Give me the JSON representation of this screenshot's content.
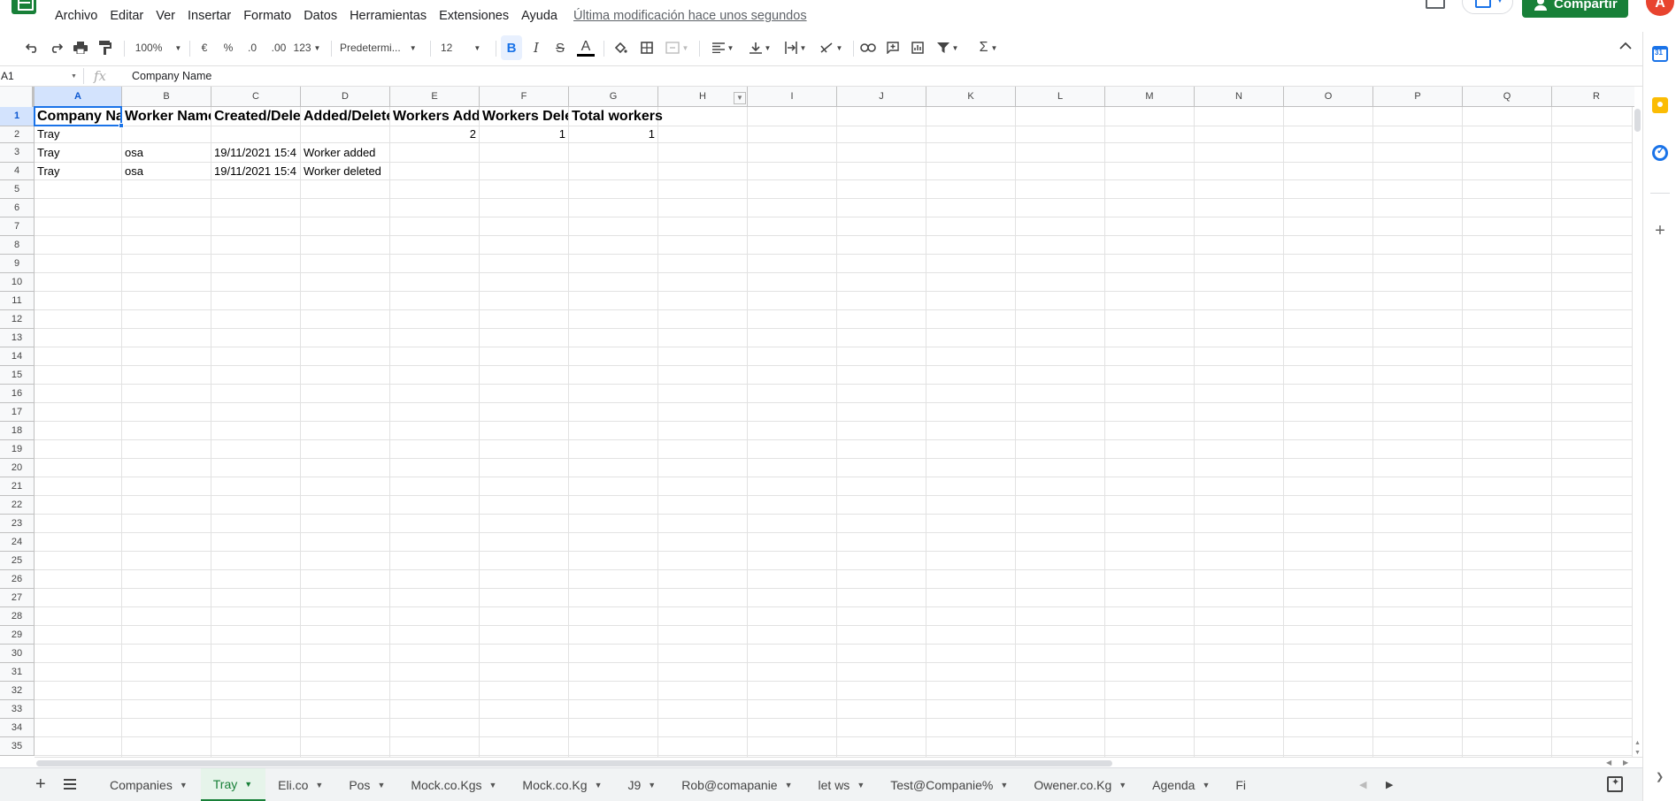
{
  "menu": {
    "items": [
      "Archivo",
      "Editar",
      "Ver",
      "Insertar",
      "Formato",
      "Datos",
      "Herramientas",
      "Extensiones",
      "Ayuda"
    ],
    "last_edit": "Última modificación hace unos segundos"
  },
  "header": {
    "share_label": "Compartir",
    "avatar_letter": "A"
  },
  "toolbar": {
    "zoom": "100%",
    "currency": "€",
    "percent": "%",
    "decrease_decimals": ".0",
    "increase_decimals": ".00",
    "more_formats": "123",
    "font": "Predetermi...",
    "font_size": "12",
    "bold": "B",
    "italic": "I",
    "strikethrough": "S",
    "text_color": "A",
    "functions": "Σ"
  },
  "formula_bar": {
    "cell_ref": "A1",
    "fx": "fx",
    "value": "Company Name"
  },
  "grid": {
    "columns": [
      "A",
      "B",
      "C",
      "D",
      "E",
      "F",
      "G",
      "H",
      "I",
      "J",
      "K",
      "L",
      "M",
      "N",
      "O",
      "P",
      "Q",
      "R"
    ],
    "rows": [
      "1",
      "2",
      "3",
      "4",
      "5",
      "6",
      "7",
      "8",
      "9",
      "10",
      "11",
      "12",
      "13",
      "14",
      "15",
      "16",
      "17",
      "18",
      "19",
      "20",
      "21",
      "22",
      "23",
      "24",
      "25",
      "26",
      "27",
      "28",
      "29",
      "30",
      "31",
      "32",
      "33",
      "34",
      "35"
    ],
    "cells": {
      "A1": "Company Name",
      "B1": "Worker Name",
      "C1": "Created/Deleted",
      "D1": "Added/Deleted",
      "E1": "Workers Added",
      "F1": "Workers Deleted",
      "G1": "Total workers",
      "A2": "Tray",
      "E2": "2",
      "F2": "1",
      "G2": "1",
      "A3": "Tray",
      "B3": "osa",
      "C3": "19/11/2021 15:4",
      "D3": "Worker added",
      "A4": "Tray",
      "B4": "osa",
      "C4": "19/11/2021 15:4",
      "D4": "Worker deleted"
    },
    "selected_cell": "A1"
  },
  "sheets": {
    "tabs": [
      "Companies",
      "Tray",
      "Eli.co",
      "Pos",
      "Mock.co.Kgs",
      "Mock.co.Kg",
      "J9",
      "Rob@comapanie",
      "let ws",
      "Test@Companie%",
      "Owener.co.Kg",
      "Agenda",
      "Fi"
    ],
    "active": "Tray"
  },
  "side_panel": {
    "calendar_day": "31"
  },
  "colors": {
    "brand_green": "#188038",
    "selection_blue": "#1a73e8",
    "avatar_red": "#e8442f"
  }
}
